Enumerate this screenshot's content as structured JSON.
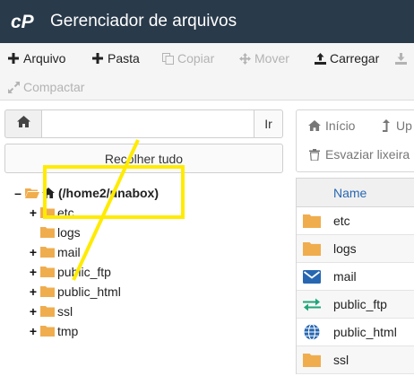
{
  "header": {
    "logo_text": "cP",
    "title": "Gerenciador de arquivos",
    "background": "#293a4a"
  },
  "toolbar": {
    "file_label": "Arquivo",
    "folder_label": "Pasta",
    "copy_label": "Copiar",
    "move_label": "Mover",
    "upload_label": "Carregar",
    "compress_label": "Compactar"
  },
  "search": {
    "value": "",
    "go_label": "Ir"
  },
  "collapse_label": "Recolher tudo",
  "tree": {
    "root_label": "(/home2/unabox)",
    "items": [
      {
        "label": "etc",
        "expandable": true
      },
      {
        "label": "logs",
        "expandable": false
      },
      {
        "label": "mail",
        "expandable": true
      },
      {
        "label": "public_ftp",
        "expandable": true
      },
      {
        "label": "public_html",
        "expandable": true
      },
      {
        "label": "ssl",
        "expandable": true
      },
      {
        "label": "tmp",
        "expandable": true
      }
    ]
  },
  "right_panel": {
    "home_label": "Início",
    "empty_trash_label": "Esvaziar lixeira"
  },
  "file_table": {
    "name_header": "Name",
    "rows": [
      {
        "label": "etc",
        "icon": "folder-icon"
      },
      {
        "label": "logs",
        "icon": "folder-icon"
      },
      {
        "label": "mail",
        "icon": "envelope-icon"
      },
      {
        "label": "public_ftp",
        "icon": "transfer-arrows-icon"
      },
      {
        "label": "public_html",
        "icon": "globe-icon"
      },
      {
        "label": "ssl",
        "icon": "folder-icon"
      }
    ]
  },
  "colors": {
    "folder": "#f0ad4e",
    "link": "#2767b2",
    "annotation": "#ffeb00"
  }
}
